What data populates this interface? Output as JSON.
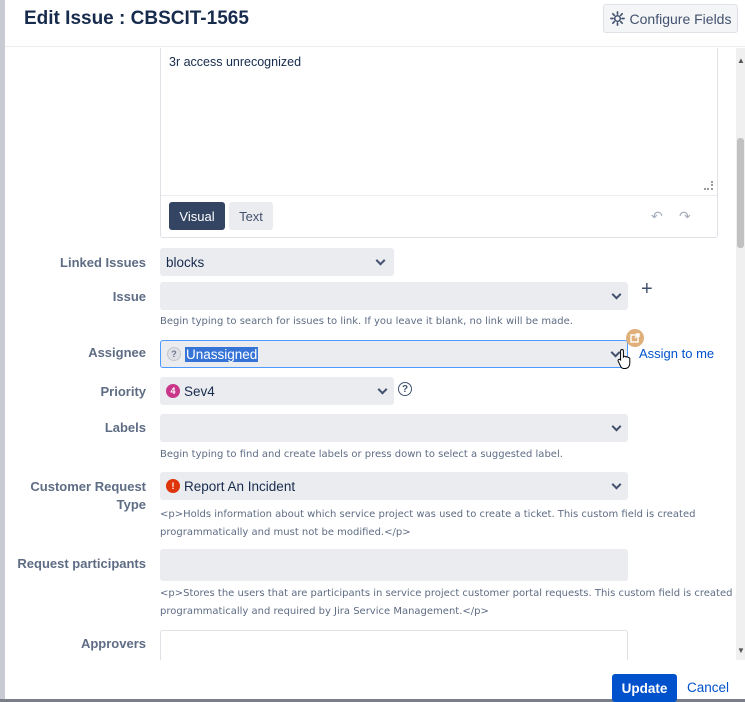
{
  "dialog": {
    "title": "Edit Issue : CBSCIT-1565",
    "configure_label": "Configure Fields",
    "icon": "gear-icon"
  },
  "editor": {
    "content": "3r access unrecognized",
    "tab_visual": "Visual",
    "tab_text": "Text"
  },
  "fields": {
    "linked_issues": {
      "label": "Linked Issues",
      "value": "blocks"
    },
    "issue": {
      "label": "Issue",
      "value": "",
      "help": "Begin typing to search for issues to link. If you leave it blank, no link will be made."
    },
    "assignee": {
      "label": "Assignee",
      "value": "Unassigned",
      "assign_to_me": "Assign to me"
    },
    "priority": {
      "label": "Priority",
      "value": "Sev4",
      "badge": "4",
      "badge_color": "#c9378a"
    },
    "labels": {
      "label": "Labels",
      "value": "",
      "help": "Begin typing to find and create labels or press down to select a suggested label."
    },
    "customer_request_type": {
      "label_line1": "Customer Request",
      "label_line2": "Type",
      "value": "Report An Incident",
      "badge_color": "#de350b",
      "help_line1": "<p>Holds information about which service project was used to create a ticket. This custom field is created",
      "help_line2": "programmatically and must not be modified.</p>"
    },
    "request_participants": {
      "label": "Request participants",
      "help_line1": "<p>Stores the users that are participants in service project customer portal requests. This custom field is created",
      "help_line2": "programmatically and required by Jira Service Management.</p>"
    },
    "approvers": {
      "label": "Approvers"
    }
  },
  "footer": {
    "update_label": "Update",
    "cancel_label": "Cancel"
  },
  "colors": {
    "primary": "#0052cc",
    "field_bg": "#ebecf0",
    "label": "#5e6c84"
  }
}
